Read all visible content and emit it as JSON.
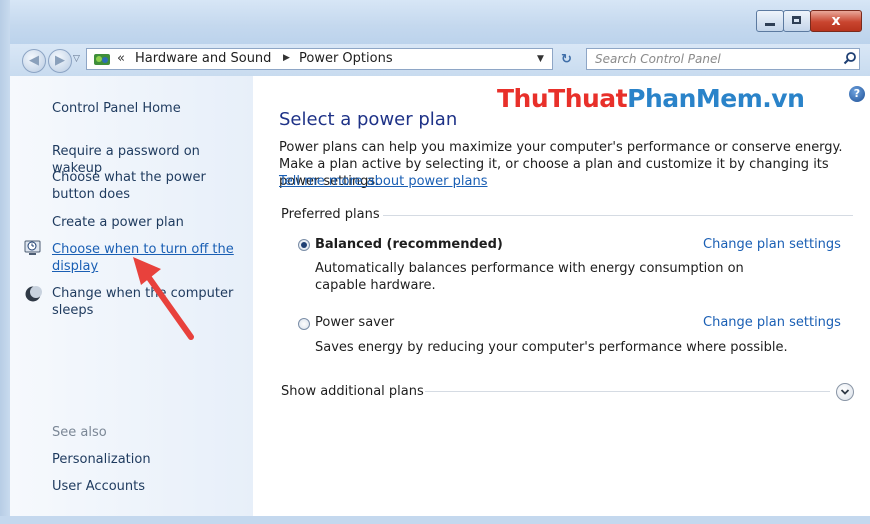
{
  "window": {
    "close_glyph": "x"
  },
  "address_bar": {
    "recent_glyph": "▽",
    "overflow_glyph": "«",
    "breadcrumbs": [
      "Hardware and Sound",
      "Power Options"
    ],
    "separator_glyph": "▶",
    "dropdown_glyph": "▼",
    "refresh_glyph": "↻"
  },
  "search": {
    "placeholder": "Search Control Panel"
  },
  "sidebar": {
    "home": "Control Panel Home",
    "tasks": [
      {
        "label": "Require a password on wakeup",
        "icon": null
      },
      {
        "label": "Choose what the power button does",
        "icon": null
      },
      {
        "label": "Create a power plan",
        "icon": null
      },
      {
        "label": "Choose when to turn off the display",
        "icon": "clock-monitor-icon",
        "active": true
      },
      {
        "label": "Change when the computer sleeps",
        "icon": "moon-icon"
      }
    ],
    "see_also_heading": "See also",
    "see_also": [
      "Personalization",
      "User Accounts"
    ]
  },
  "watermark": {
    "part1": "ThuThuat",
    "part2": "PhanMem.vn",
    "color1": "#e8302a",
    "color2": "#2a83c9"
  },
  "main": {
    "help_glyph": "?",
    "title": "Select a power plan",
    "intro": "Power plans can help you maximize your computer's performance or conserve energy. Make a plan active by selecting it, or choose a plan and customize it by changing its power settings.",
    "learn_more": "Tell me more about power plans",
    "preferred_heading": "Preferred plans",
    "plans": [
      {
        "name": "Balanced (recommended)",
        "selected": true,
        "description": "Automatically balances performance with energy consumption on capable hardware.",
        "settings_link": "Change plan settings"
      },
      {
        "name": "Power saver",
        "selected": false,
        "description": "Saves energy by reducing your computer's performance where possible.",
        "settings_link": "Change plan settings"
      }
    ],
    "show_additional": "Show additional plans",
    "expand_glyph": "⌄"
  }
}
